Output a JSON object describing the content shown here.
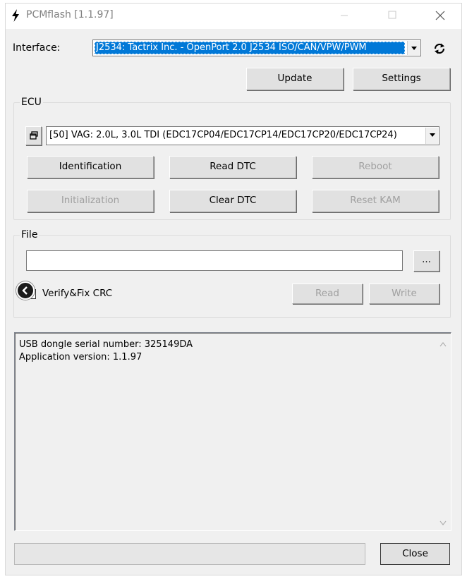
{
  "window": {
    "title": "PCMflash [1.1.97]",
    "icons": [
      "lightning-icon",
      "minimize-icon",
      "maximize-icon",
      "close-icon"
    ]
  },
  "interface": {
    "label": "Interface:",
    "selected": "J2534: Tactrix Inc. - OpenPort 2.0 J2534 ISO/CAN/VPW/PWM",
    "refresh_icon": "refresh-icon"
  },
  "top_buttons": {
    "update": "Update",
    "settings": "Settings"
  },
  "ecu": {
    "title": "ECU",
    "selected": "[50] VAG: 2.0L, 3.0L TDI (EDC17CP04/EDC17CP14/EDC17CP20/EDC17CP24)",
    "buttons": {
      "identification": "Identification",
      "read_dtc": "Read DTC",
      "reboot": "Reboot",
      "initialization": "Initialization",
      "clear_dtc": "Clear DTC",
      "reset_kam": "Reset KAM"
    }
  },
  "file": {
    "title": "File",
    "path_value": "",
    "browse": "...",
    "verify_label": "Verify&Fix CRC",
    "read": "Read",
    "write": "Write"
  },
  "log": {
    "lines": [
      "USB dongle serial number: 325149DA",
      "Application version: 1.1.97"
    ]
  },
  "footer": {
    "status": "",
    "close": "Close"
  },
  "colors": {
    "selection": "#0078d7",
    "disabled_text": "#a0a0a0"
  }
}
